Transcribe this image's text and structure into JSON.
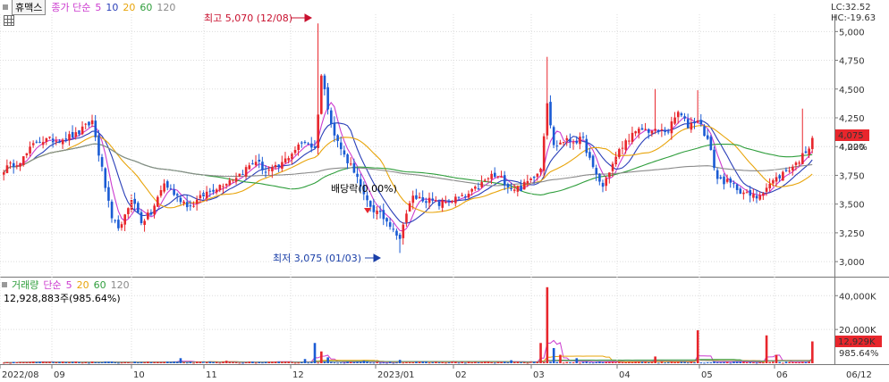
{
  "header": {
    "symbol": "휴맥스",
    "ma_label": "종가 단순",
    "ma_periods": [
      "5",
      "10",
      "20",
      "60",
      "120"
    ],
    "lc": "LC:32.52",
    "hc": "HC:-19.63"
  },
  "volume_header": {
    "label": "거래량",
    "ma_label": "단순",
    "ma_periods": [
      "5",
      "20",
      "60",
      "120"
    ],
    "info": "12,928,883주(985.64%)"
  },
  "colors": {
    "up": "#e8262c",
    "down": "#1a5bd4",
    "ma5": "#cc3ccf",
    "ma10": "#2a3fb8",
    "ma20": "#e8a40a",
    "ma60": "#2f9e3c",
    "ma120": "#8a8a8a",
    "price_tag": "#e8262c"
  },
  "annotations": {
    "high_text": "최고 5,070 (12/08)",
    "low_text": "최저 3,075 (01/03)",
    "ex_rights": "배당락(0.00%)"
  },
  "price_tag": {
    "price": "4,075",
    "pct": "4.22%"
  },
  "volume_tag": {
    "value": "12,929K",
    "pct": "985.64%"
  },
  "chart_data": [
    {
      "type": "candlestick",
      "title": "",
      "ylim": [
        2900,
        5150
      ],
      "y_ticks": [
        "3,000",
        "3,250",
        "3,500",
        "3,750",
        "4,000",
        "4,250",
        "4,500",
        "4,750",
        "5,000"
      ],
      "x_ticks": [
        "2022/08",
        "09",
        "10",
        "11",
        "12",
        "2023/01",
        "02",
        "03",
        "04",
        "05",
        "06"
      ],
      "right_bottom_label": "06/12",
      "anchors": [
        [
          0,
          3800
        ],
        [
          6,
          3900
        ],
        [
          10,
          4050
        ],
        [
          16,
          4060
        ],
        [
          22,
          4100
        ],
        [
          27,
          4220
        ],
        [
          30,
          3800
        ],
        [
          33,
          3350
        ],
        [
          36,
          3300
        ],
        [
          39,
          3560
        ],
        [
          42,
          3350
        ],
        [
          45,
          3420
        ],
        [
          49,
          3680
        ],
        [
          53,
          3560
        ],
        [
          57,
          3480
        ],
        [
          62,
          3600
        ],
        [
          67,
          3680
        ],
        [
          72,
          3760
        ],
        [
          77,
          3880
        ],
        [
          80,
          3780
        ],
        [
          84,
          3820
        ],
        [
          88,
          3950
        ],
        [
          92,
          4050
        ],
        [
          95,
          3980
        ],
        [
          97,
          4620
        ],
        [
          99,
          4350
        ],
        [
          101,
          4100
        ],
        [
          104,
          3920
        ],
        [
          107,
          3800
        ],
        [
          110,
          3560
        ],
        [
          113,
          3450
        ],
        [
          116,
          3380
        ],
        [
          119,
          3300
        ],
        [
          121,
          3180
        ],
        [
          122,
          3350
        ],
        [
          125,
          3560
        ],
        [
          129,
          3540
        ],
        [
          133,
          3500
        ],
        [
          137,
          3540
        ],
        [
          141,
          3560
        ],
        [
          145,
          3650
        ],
        [
          149,
          3750
        ],
        [
          152,
          3720
        ],
        [
          155,
          3640
        ],
        [
          158,
          3640
        ],
        [
          161,
          3720
        ],
        [
          164,
          3820
        ],
        [
          166,
          4400
        ],
        [
          168,
          4000
        ],
        [
          171,
          4050
        ],
        [
          174,
          4050
        ],
        [
          177,
          4060
        ],
        [
          180,
          3800
        ],
        [
          183,
          3650
        ],
        [
          185,
          3790
        ],
        [
          188,
          3960
        ],
        [
          191,
          4080
        ],
        [
          195,
          4150
        ],
        [
          199,
          4130
        ],
        [
          203,
          4140
        ],
        [
          206,
          4300
        ],
        [
          209,
          4180
        ],
        [
          212,
          4240
        ],
        [
          215,
          4060
        ],
        [
          218,
          3720
        ],
        [
          221,
          3690
        ],
        [
          224,
          3640
        ],
        [
          227,
          3580
        ],
        [
          230,
          3560
        ],
        [
          233,
          3650
        ],
        [
          236,
          3720
        ],
        [
          239,
          3790
        ],
        [
          242,
          3850
        ],
        [
          244,
          3920
        ],
        [
          247,
          4050
        ]
      ],
      "high_label_value": 5070,
      "low_label_value": 3075,
      "last_price": 4075
    },
    {
      "type": "bar",
      "title": "",
      "y_ticks": [
        "20,000K",
        "40,000K"
      ],
      "ylim": [
        0,
        47000
      ],
      "spikes": [
        [
          54,
          3000
        ],
        [
          68,
          1500
        ],
        [
          92,
          2500
        ],
        [
          95,
          12000
        ],
        [
          97,
          7000
        ],
        [
          99,
          3500
        ],
        [
          110,
          1500
        ],
        [
          121,
          2000
        ],
        [
          155,
          1800
        ],
        [
          164,
          12000
        ],
        [
          166,
          45000
        ],
        [
          168,
          9000
        ],
        [
          170,
          5000
        ],
        [
          175,
          3000
        ],
        [
          199,
          4000
        ],
        [
          212,
          19500
        ],
        [
          233,
          16500
        ],
        [
          236,
          5000
        ],
        [
          247,
          12929
        ]
      ]
    }
  ]
}
